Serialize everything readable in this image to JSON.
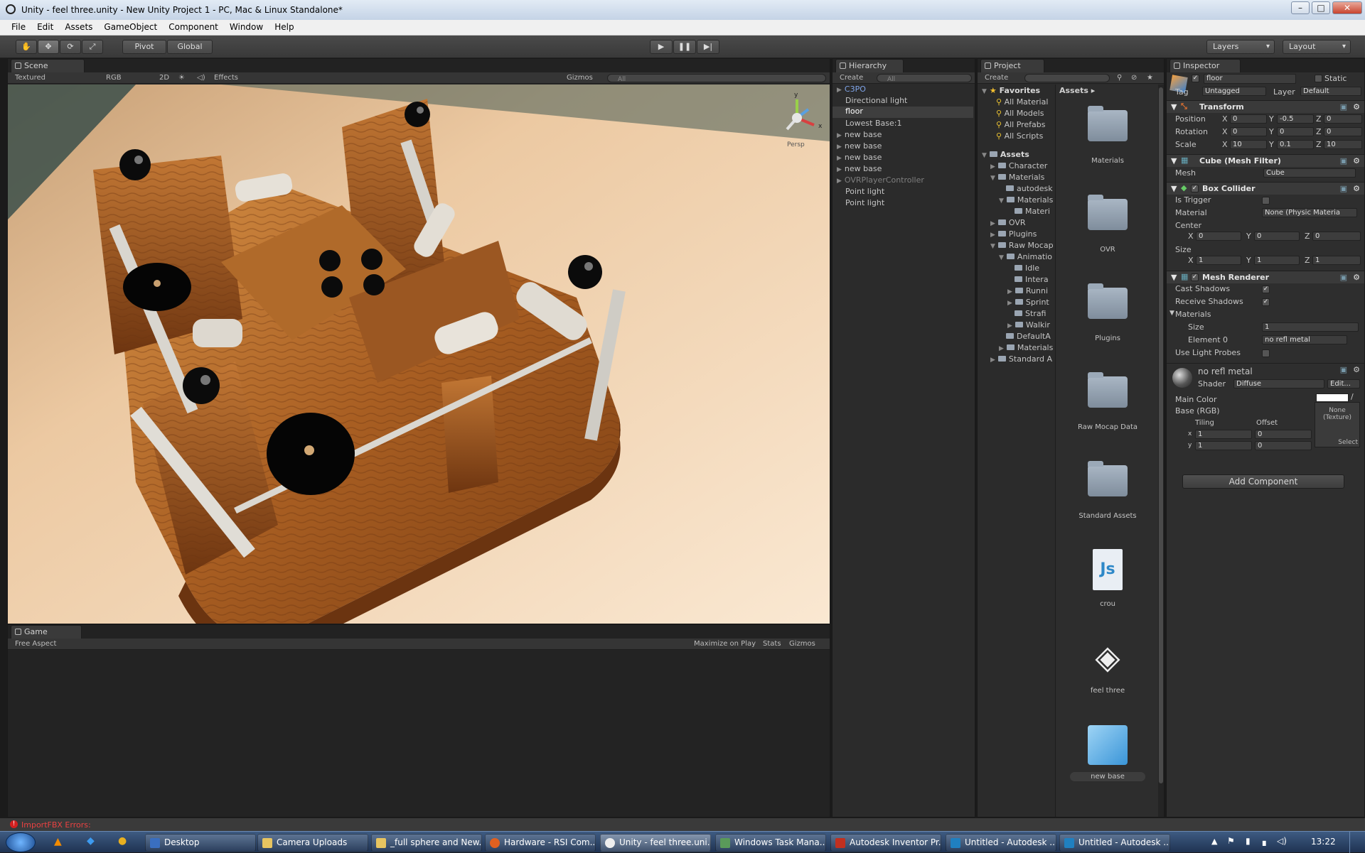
{
  "window": {
    "title": "Unity - feel three.unity - New Unity Project 1 - PC, Mac & Linux Standalone*"
  },
  "menu": [
    "File",
    "Edit",
    "Assets",
    "GameObject",
    "Component",
    "Window",
    "Help"
  ],
  "toolbar": {
    "pivot": "Pivot",
    "global": "Global",
    "layers": "Layers",
    "layout": "Layout"
  },
  "scene": {
    "tab": "Scene",
    "render_mode": "Textured",
    "color_mode": "RGB",
    "mode2d": "2D",
    "effects": "Effects",
    "gizmos": "Gizmos",
    "search_placeholder": "All",
    "persp_label": "Persp"
  },
  "game": {
    "tab": "Game",
    "aspect": "Free Aspect",
    "maximize": "Maximize on Play",
    "stats": "Stats",
    "gizmos": "Gizmos"
  },
  "hierarchy": {
    "tab": "Hierarchy",
    "create": "Create",
    "search_placeholder": "All",
    "items": [
      "C3PO",
      "Directional light",
      "floor",
      "Lowest Base:1",
      "new base",
      "new base",
      "new base",
      "new base",
      "OVRPlayerController",
      "Point light",
      "Point light"
    ]
  },
  "project": {
    "tab": "Project",
    "create": "Create",
    "favorites_label": "Favorites",
    "favorites": [
      "All Material",
      "All Models",
      "All Prefabs",
      "All Scripts"
    ],
    "assets_label": "Assets",
    "tree": [
      "Character",
      "Materials",
      "autodesk",
      "Materials",
      "Materi",
      "OVR",
      "Plugins",
      "Raw Mocap",
      "Animatio",
      "Idle",
      "Intera",
      "Runni",
      "Sprint",
      "Strafi",
      "Walkir",
      "DefaultA",
      "Materials",
      "Standard A"
    ],
    "breadcrumb": "Assets",
    "grid": [
      "Materials",
      "OVR",
      "Plugins",
      "Raw Mocap Data",
      "Standard Assets",
      "crou",
      "feel three",
      "new base"
    ]
  },
  "inspector": {
    "tab": "Inspector",
    "name": "floor",
    "static": "Static",
    "tag_label": "Tag",
    "tag": "Untagged",
    "layer_label": "Layer",
    "layer": "Default",
    "transform": {
      "title": "Transform",
      "position_label": "Position",
      "rotation_label": "Rotation",
      "scale_label": "Scale",
      "position": {
        "x": "0",
        "y": "-0.5",
        "z": "0"
      },
      "rotation": {
        "x": "0",
        "y": "0",
        "z": "0"
      },
      "scale": {
        "x": "10",
        "y": "0.1",
        "z": "10"
      }
    },
    "mesh_filter": {
      "title": "Cube (Mesh Filter)",
      "mesh_label": "Mesh",
      "mesh": "Cube"
    },
    "box_collider": {
      "title": "Box Collider",
      "trigger_label": "Is Trigger",
      "material_label": "Material",
      "material": "None (Physic Materia",
      "center_label": "Center",
      "center": {
        "x": "0",
        "y": "0",
        "z": "0"
      },
      "size_label": "Size",
      "size": {
        "x": "1",
        "y": "1",
        "z": "1"
      }
    },
    "mesh_renderer": {
      "title": "Mesh Renderer",
      "cast": "Cast Shadows",
      "receive": "Receive Shadows",
      "materials": "Materials",
      "size_label": "Size",
      "size": "1",
      "element0_label": "Element 0",
      "element0": "no refl metal",
      "probes": "Use Light Probes"
    },
    "material": {
      "name": "no refl metal",
      "shader_label": "Shader",
      "shader": "Diffuse",
      "edit": "Edit...",
      "main_color": "Main Color",
      "base": "Base (RGB)",
      "tiling": "Tiling",
      "offset": "Offset",
      "tx": "1",
      "ty": "1",
      "ox": "0",
      "oy": "0",
      "texture": "None (Texture)",
      "select": "Select"
    },
    "add_component": "Add Component"
  },
  "console": {
    "error": "ImportFBX Errors:"
  },
  "taskbar": {
    "items": [
      "Desktop",
      "Camera Uploads",
      "_full sphere and New...",
      "Hardware - RSI Com...",
      "Unity - feel three.uni...",
      "Windows Task Mana...",
      "Autodesk Inventor Pr...",
      "Untitled - Autodesk ...",
      "Untitled - Autodesk ..."
    ],
    "clock": "13:22"
  },
  "colors": {
    "editor_bg": "#2b2b2b",
    "floor": "#f2d9b8",
    "wood": "#b9702f"
  }
}
